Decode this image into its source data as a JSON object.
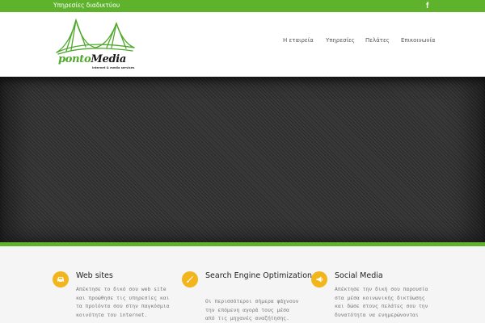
{
  "topbar": {
    "text": "Υπηρεσίες διαδικτύου",
    "social_icon": "facebook-icon",
    "social_glyph": "f"
  },
  "logo": {
    "word_part1": "ponto",
    "word_part2": "Media",
    "tagline": "internet & media services"
  },
  "nav": {
    "items": [
      {
        "label": "Η εταιρεία"
      },
      {
        "label": "Υπηρεσίες"
      },
      {
        "label": "Πελάτες"
      },
      {
        "label": "Επικοινωνία"
      }
    ]
  },
  "features": {
    "items": [
      {
        "icon": "car-icon",
        "title_lines": [
          "Web sites"
        ],
        "text_lines": [
          "Απέκτησε το δικό σου web site",
          "και προώθησε τις υπηρεσίες και",
          "τα προϊόντα σου στην παγκόσμια",
          "κοινότητα του internet."
        ]
      },
      {
        "icon": "brush-icon",
        "title_lines": [
          "Search Engine",
          "Optimization"
        ],
        "text_lines": [
          "Οι περισσότεροι σήμερα ψάχνουν",
          "την επόμενη αγορά τους μέσα",
          "από τις μηχανές αναζήτησης."
        ]
      },
      {
        "icon": "megaphone-icon",
        "title_lines": [
          "Social Media"
        ],
        "text_lines": [
          "Απέκτησε την δική σου παρουσία",
          "στα μέσα κοινωνικής δικτύωσης",
          "και δώσε στους πελάτες σου την",
          "δυνατότητα να ενημερώνονται"
        ]
      }
    ]
  },
  "colors": {
    "brand_green": "#5fb22c",
    "accent_yellow": "#f2b51c",
    "hero_dark": "#3a3a3a"
  }
}
